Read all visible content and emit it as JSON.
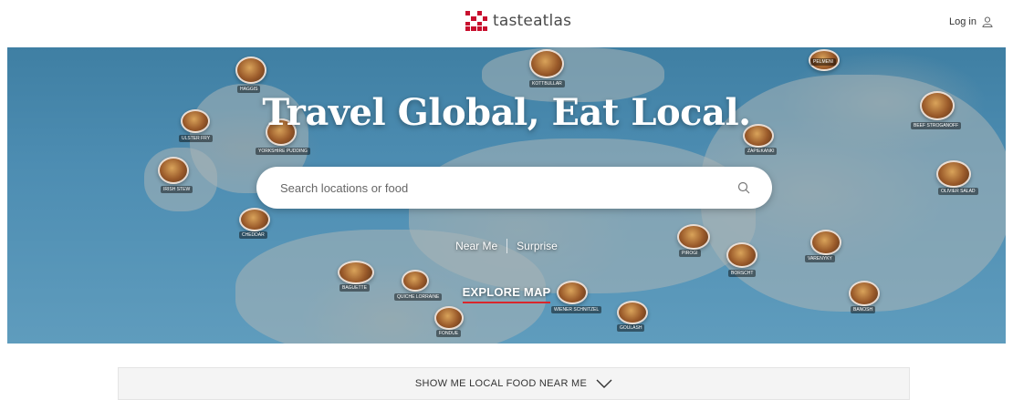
{
  "header": {
    "logo_text": "tasteatlas",
    "login_label": "Log in"
  },
  "hero": {
    "title": "Travel Global, Eat Local.",
    "search_placeholder": "Search locations or food",
    "near_me_label": "Near Me",
    "surprise_label": "Surprise",
    "explore_label": "EXPLORE MAP",
    "dish_labels": [
      "Haggis",
      "Kottbullar",
      "Ulster Fry",
      "Yorkshire Pudding",
      "Pelmeni",
      "Beef Stroganoff",
      "Irish Stew",
      "Zapiekanki",
      "Cheddar",
      "Pirogi",
      "Borscht",
      "Baguette",
      "Goulash",
      "Banosh",
      "Varenyky",
      "Olivier Salad",
      "Fondue",
      "Wiener Schnitzel",
      "Quiche Lorraine"
    ]
  },
  "near_bar": {
    "label": "SHOW ME LOCAL FOOD NEAR ME"
  },
  "colors": {
    "brand_red": "#c8102e",
    "accent_underline": "#d9262c"
  },
  "icons": [
    "tasteatlas-logo-icon",
    "user-icon",
    "search-icon",
    "chevron-down-icon"
  ]
}
